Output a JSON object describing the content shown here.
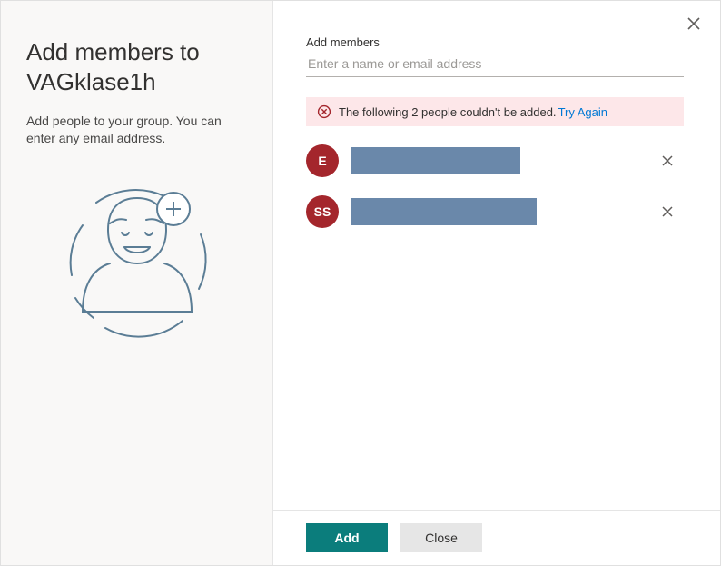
{
  "left": {
    "title_line1": "Add members to",
    "title_line2": "VAGklase1h",
    "description": "Add people to your group. You can enter any email address."
  },
  "input": {
    "label": "Add members",
    "placeholder": "Enter a name or email address",
    "value": ""
  },
  "error": {
    "message": "The following 2 people couldn't be added.",
    "retry_label": "Try Again"
  },
  "members": [
    {
      "initials": "E",
      "redacted_width": 186
    },
    {
      "initials": "SS",
      "redacted_width": 204
    }
  ],
  "footer": {
    "primary_label": "Add",
    "secondary_label": "Close"
  }
}
